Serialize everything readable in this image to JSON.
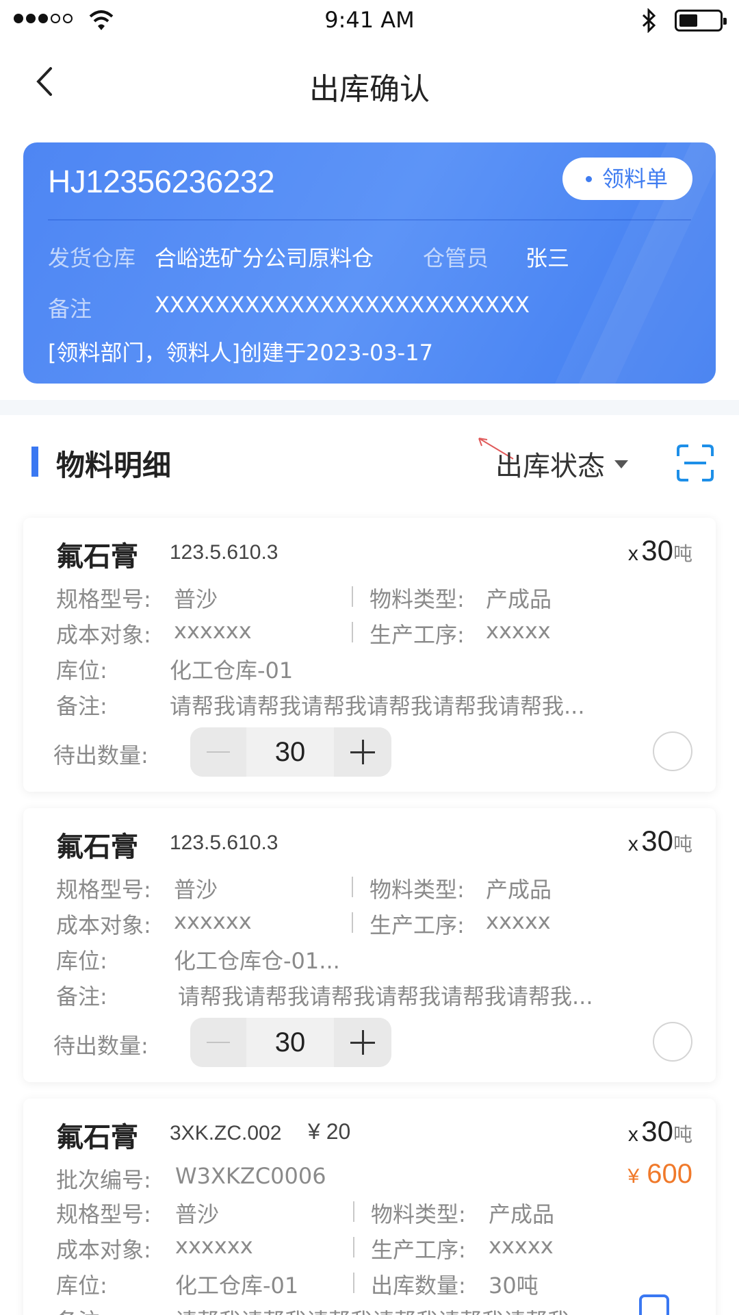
{
  "status_bar": {
    "time": "9:41 AM"
  },
  "nav": {
    "title": "出库确认"
  },
  "header": {
    "order_no": "HJ12356236232",
    "tag": "领料单",
    "warehouse_label": "发货仓库",
    "warehouse_value": "合峪选矿分公司原料仓",
    "keeper_label": "仓管员",
    "keeper_value": "张三",
    "remark_label": "备注",
    "remark_value": "XXXXXXXXXXXXXXXXXXXXXXXXX",
    "created": "[领料部门，领料人]创建于2023-03-17"
  },
  "section": {
    "title": "物料明细",
    "filter": "出库状态"
  },
  "items": [
    {
      "name": "氟石膏",
      "code": "123.5.610.3",
      "qty_x": "x",
      "qty": "30",
      "unit": "吨",
      "spec_label": "规格型号:",
      "spec": "普沙",
      "type_label": "物料类型:",
      "type": "产成品",
      "cost_label": "成本对象:",
      "cost": "xxxxxx",
      "proc_label": "生产工序:",
      "proc": "xxxxx",
      "loc_label": "库位:",
      "loc": "化工仓库-01",
      "remark_label": "备注:",
      "remark": "请帮我请帮我请帮我请帮我请帮我请帮我...",
      "pending_label": "待出数量:",
      "pending": "30"
    },
    {
      "name": "氟石膏",
      "code": "123.5.610.3",
      "qty_x": "x",
      "qty": "30",
      "unit": "吨",
      "spec_label": "规格型号:",
      "spec": "普沙",
      "type_label": "物料类型:",
      "type": "产成品",
      "cost_label": "成本对象:",
      "cost": "xxxxxx",
      "proc_label": "生产工序:",
      "proc": "xxxxx",
      "loc_label": "库位:",
      "loc": "化工仓库仓-01...",
      "remark_label": "备注:",
      "remark": "请帮我请帮我请帮我请帮我请帮我请帮我...",
      "pending_label": "待出数量:",
      "pending": "30"
    },
    {
      "name": "氟石膏",
      "code": "3XK.ZC.002",
      "price": "¥ 20",
      "qty_x": "x",
      "qty": "30",
      "unit": "吨",
      "batch_label": "批次编号:",
      "batch": "W3XKZC0006",
      "amount_yen": "¥",
      "amount": "600",
      "spec_label": "规格型号:",
      "spec": "普沙",
      "type_label": "物料类型:",
      "type": "产成品",
      "cost_label": "成本对象:",
      "cost": "xxxxxx",
      "proc_label": "生产工序:",
      "proc": "xxxxx",
      "loc_label": "库位:",
      "loc": "化工仓库-01",
      "out_label": "出库数量:",
      "out": "30吨",
      "remark_label": "备注:",
      "remark": "请帮我请帮我请帮我请帮我请帮我请帮我..."
    }
  ],
  "colors": {
    "primary": "#3a78f2",
    "accent_orange": "#f0792a"
  }
}
